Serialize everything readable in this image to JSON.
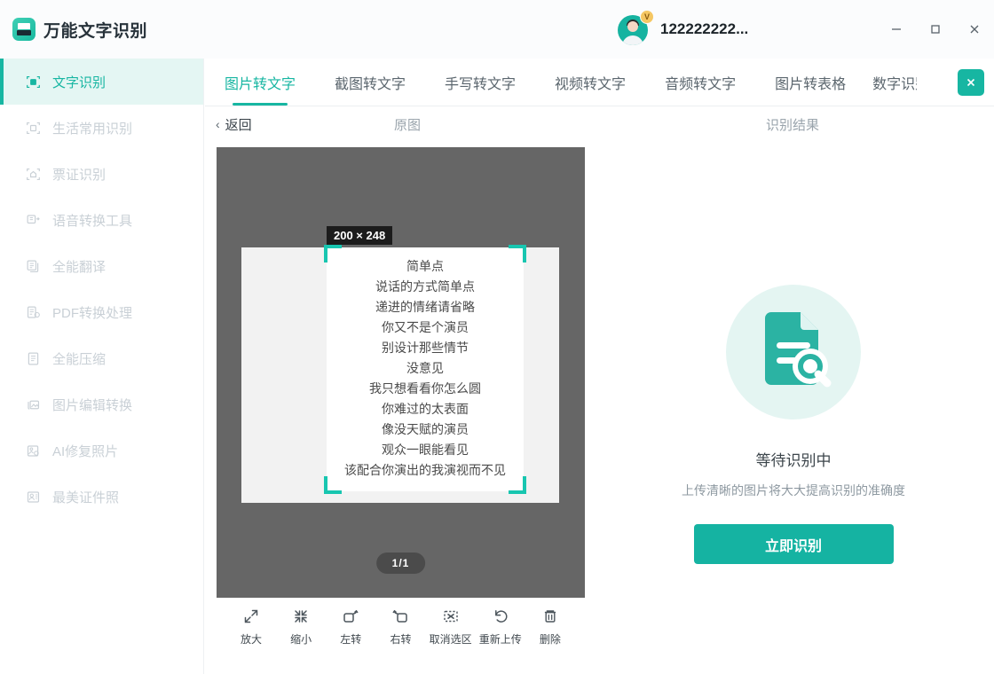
{
  "app": {
    "title": "万能文字识别",
    "icon": "scan-document-icon"
  },
  "account": {
    "name": "122222222...",
    "vip_badge": "V"
  },
  "window_controls": {
    "minimize": "minimize-icon",
    "maximize": "maximize-icon",
    "close": "close-icon"
  },
  "sidebar": {
    "items": [
      {
        "label": "文字识别",
        "icon": "text-recognition-icon",
        "active": true
      },
      {
        "label": "生活常用识别",
        "icon": "daily-recognition-icon",
        "active": false
      },
      {
        "label": "票证识别",
        "icon": "ticket-recognition-icon",
        "active": false
      },
      {
        "label": "语音转换工具",
        "icon": "voice-convert-icon",
        "active": false
      },
      {
        "label": "全能翻译",
        "icon": "translate-icon",
        "active": false
      },
      {
        "label": "PDF转换处理",
        "icon": "pdf-convert-icon",
        "active": false
      },
      {
        "label": "全能压缩",
        "icon": "compress-icon",
        "active": false
      },
      {
        "label": "图片编辑转换",
        "icon": "image-edit-icon",
        "active": false
      },
      {
        "label": "AI修复照片",
        "icon": "ai-restore-icon",
        "active": false
      },
      {
        "label": "最美证件照",
        "icon": "id-photo-icon",
        "active": false
      }
    ]
  },
  "tabs": {
    "items": [
      {
        "label": "图片转文字",
        "active": true
      },
      {
        "label": "截图转文字",
        "active": false
      },
      {
        "label": "手写转文字",
        "active": false
      },
      {
        "label": "视频转文字",
        "active": false
      },
      {
        "label": "音频转文字",
        "active": false
      },
      {
        "label": "图片转表格",
        "active": false
      },
      {
        "label": "数字识别",
        "active": false
      }
    ],
    "close_label": "×"
  },
  "subheader": {
    "back_label": "返回",
    "back_chevron": "‹",
    "original_label": "原图",
    "result_label": "识别结果"
  },
  "preview": {
    "selection_size": "200 × 248",
    "page_indicator": "1/1",
    "document_lines": [
      "简单点",
      "说话的方式简单点",
      "递进的情绪请省略",
      "你又不是个演员",
      "别设计那些情节",
      "没意见",
      "我只想看看你怎么圆",
      "你难过的太表面",
      "像没天赋的演员",
      "观众一眼能看见",
      "该配合你演出的我演视而不见"
    ]
  },
  "toolbar": {
    "items": [
      {
        "label": "放大",
        "icon": "zoom-in-icon"
      },
      {
        "label": "缩小",
        "icon": "zoom-out-icon"
      },
      {
        "label": "左转",
        "icon": "rotate-left-icon"
      },
      {
        "label": "右转",
        "icon": "rotate-right-icon"
      },
      {
        "label": "取消选区",
        "icon": "cancel-selection-icon"
      },
      {
        "label": "重新上传",
        "icon": "reupload-icon"
      },
      {
        "label": "删除",
        "icon": "delete-icon"
      }
    ]
  },
  "result": {
    "illustration": "document-search-icon",
    "status": "等待识别中",
    "hint": "上传清晰的图片将大大提高识别的准确度",
    "action_label": "立即识别"
  },
  "colors": {
    "accent": "#17b6a2",
    "accent_light": "#e4f6f3",
    "canvas": "#666666",
    "text_primary": "#3c454b",
    "text_muted": "#9aa4ac",
    "sidebar_inactive": "#c9d0d6"
  }
}
